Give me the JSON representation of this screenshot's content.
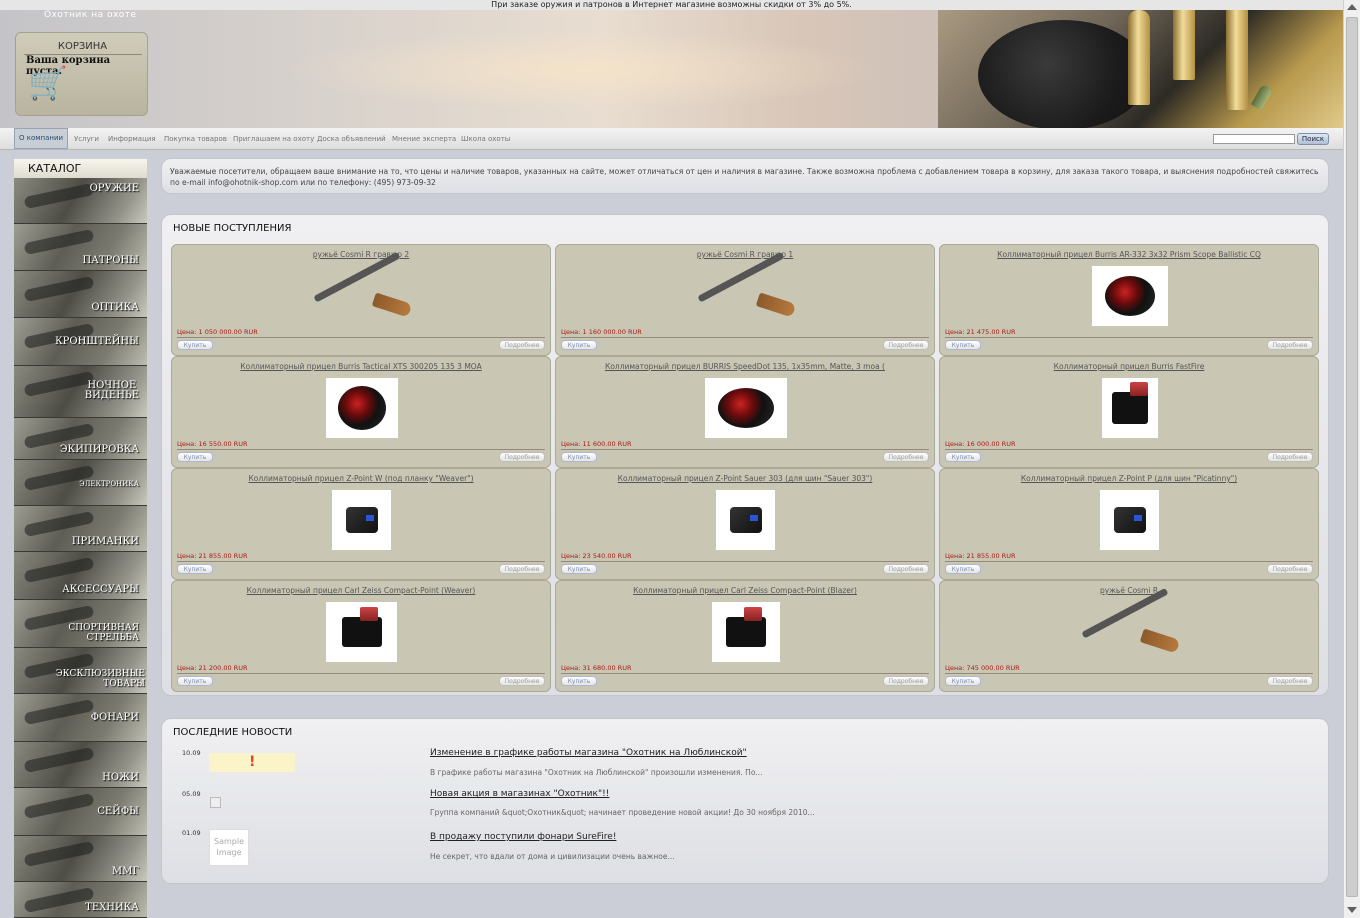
{
  "promo": "При заказе оружия и патронов в Интернет магазине возможны скидки от 3% до 5%.",
  "brand": "Охотник на охоте",
  "cart": {
    "title": "КОРЗИНА",
    "empty": "Ваша корзина пуста.",
    "icon": "shopping-cart-icon"
  },
  "nav": {
    "items": [
      "О компании",
      "Услуги",
      "Информация",
      "Покупка товаров",
      "Приглашаем на охоту",
      "Доска объявлений",
      "Мнение эксперта",
      "Школа охоты"
    ],
    "search_button": "Поиск"
  },
  "catalog": {
    "title": "КАТАЛОГ",
    "items": [
      "ОРУЖИЕ",
      "ПАТРОНЫ",
      "ОПТИКА",
      "КРОНШТЕЙНЫ",
      "НОЧНОЕ\nВИДЕНЬЕ",
      "ЭКИПИРОВКА",
      "ЭЛЕКТРОНИКА",
      "ПРИМАНКИ",
      "АКСЕССУАРЫ",
      "СПОРТИВНАЯ СТРЕЛЬБА",
      "ЭКСКЛЮЗИВНЫЕ ТОВАРЫ",
      "ФОНАРИ",
      "НОЖИ",
      "СЕЙФЫ",
      "ММГ",
      "ТЕХНИКА"
    ]
  },
  "notice": "Уважаемые посетители, обращаем ваше внимание на то, что цены и наличие товаров, указанных на сайте, может отличаться от цен и наличия в магазине. Также возможна проблема с добавлением товара в корзину, для заказа такого товара, и выяснения подробностей свяжитесь по e-mail info@ohotnik-shop.com или по телефону: (495) 973-09-32",
  "new_arrivals": {
    "title": "НОВЫЕ ПОСТУПЛЕНИЯ",
    "buy_label": "Купить",
    "more_label": "Подробнее",
    "products": [
      {
        "name": "ружьё Cosmi R гравюр 2",
        "price": "Цена: 1 050 000.00 RUR"
      },
      {
        "name": "ружьё Cosmi R гравюр 1",
        "price": "Цена: 1 160 000.00 RUR"
      },
      {
        "name": "Коллиматорный прицел Burris AR-332 3x32 Prism Scope Ballistic CQ",
        "price": "Цена: 21 475.00 RUR"
      },
      {
        "name": "Коллиматорный прицел Burris Tactical XTS 300205 135 3 MOA",
        "price": "Цена: 16 550.00 RUR"
      },
      {
        "name": "Коллиматорный прицел BURRIS SpeedDot 135, 1x35mm, Matte, 3 moa (",
        "price": "Цена: 11 600.00 RUR"
      },
      {
        "name": "Коллиматорный прицел Burris FastFire",
        "price": "Цена: 16 000.00 RUR"
      },
      {
        "name": "Коллиматорный прицел Z-Point W (под планку \"Weaver\")",
        "price": "Цена: 21 855.00 RUR"
      },
      {
        "name": "Коллиматорный прицел Z-Point Sauer 303 (для шин \"Sauer 303\")",
        "price": "Цена: 23 540.00 RUR"
      },
      {
        "name": "Коллиматорный прицел Z-Point P (для шин \"Picatinny\")",
        "price": "Цена: 21 855.00 RUR"
      },
      {
        "name": "Коллиматорный прицел Carl Zeiss Compact-Point (Weaver)",
        "price": "Цена: 21 200.00 RUR"
      },
      {
        "name": "Коллиматорный прицел Carl Zeiss Compact-Point (Blazer)",
        "price": "Цена: 31 680.00 RUR"
      },
      {
        "name": "ружьё Cosmi R",
        "price": "Цена: 745 000.00 RUR"
      }
    ]
  },
  "news": {
    "title": "ПОСЛЕДНИЕ НОВОСТИ",
    "items": [
      {
        "date": "10.09",
        "title": "Изменение в графике работы магазина \"Охотник на Люблинской\"",
        "desc": "В графике работы магазина \"Охотник на Люблинской\" произошли изменения. По..."
      },
      {
        "date": "05.09",
        "title": "Новая акция в магазинах \"Охотник\"!!",
        "desc": "Группа компаний &quot;Охотник&quot; начинает проведение новой акции! До 30 ноября 2010..."
      },
      {
        "date": "01.09",
        "title": "В продажу поступили фонари SureFire!",
        "desc": "Не секрет, что вдали от дома и цивилизации очень важное..."
      }
    ],
    "sample_image": "Sample Image"
  }
}
